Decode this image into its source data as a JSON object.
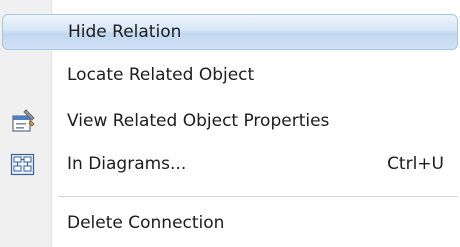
{
  "menu": {
    "items": [
      {
        "label": "Hide Relation",
        "shortcut": "",
        "icon": "",
        "highlighted": true
      },
      {
        "label": "Locate Related Object",
        "shortcut": "",
        "icon": ""
      },
      {
        "label": "View Related Object Properties",
        "shortcut": "",
        "icon": "properties-icon"
      },
      {
        "label": "In Diagrams...",
        "shortcut": "Ctrl+U",
        "icon": "diagram-icon"
      },
      {
        "label": "Delete Connection",
        "shortcut": "",
        "icon": ""
      }
    ]
  },
  "colors": {
    "highlight_border": "#a9c6e6",
    "highlight_fill": "#d6e6f7",
    "gutter": "#f0f0f0",
    "text": "#1c1c1c"
  }
}
